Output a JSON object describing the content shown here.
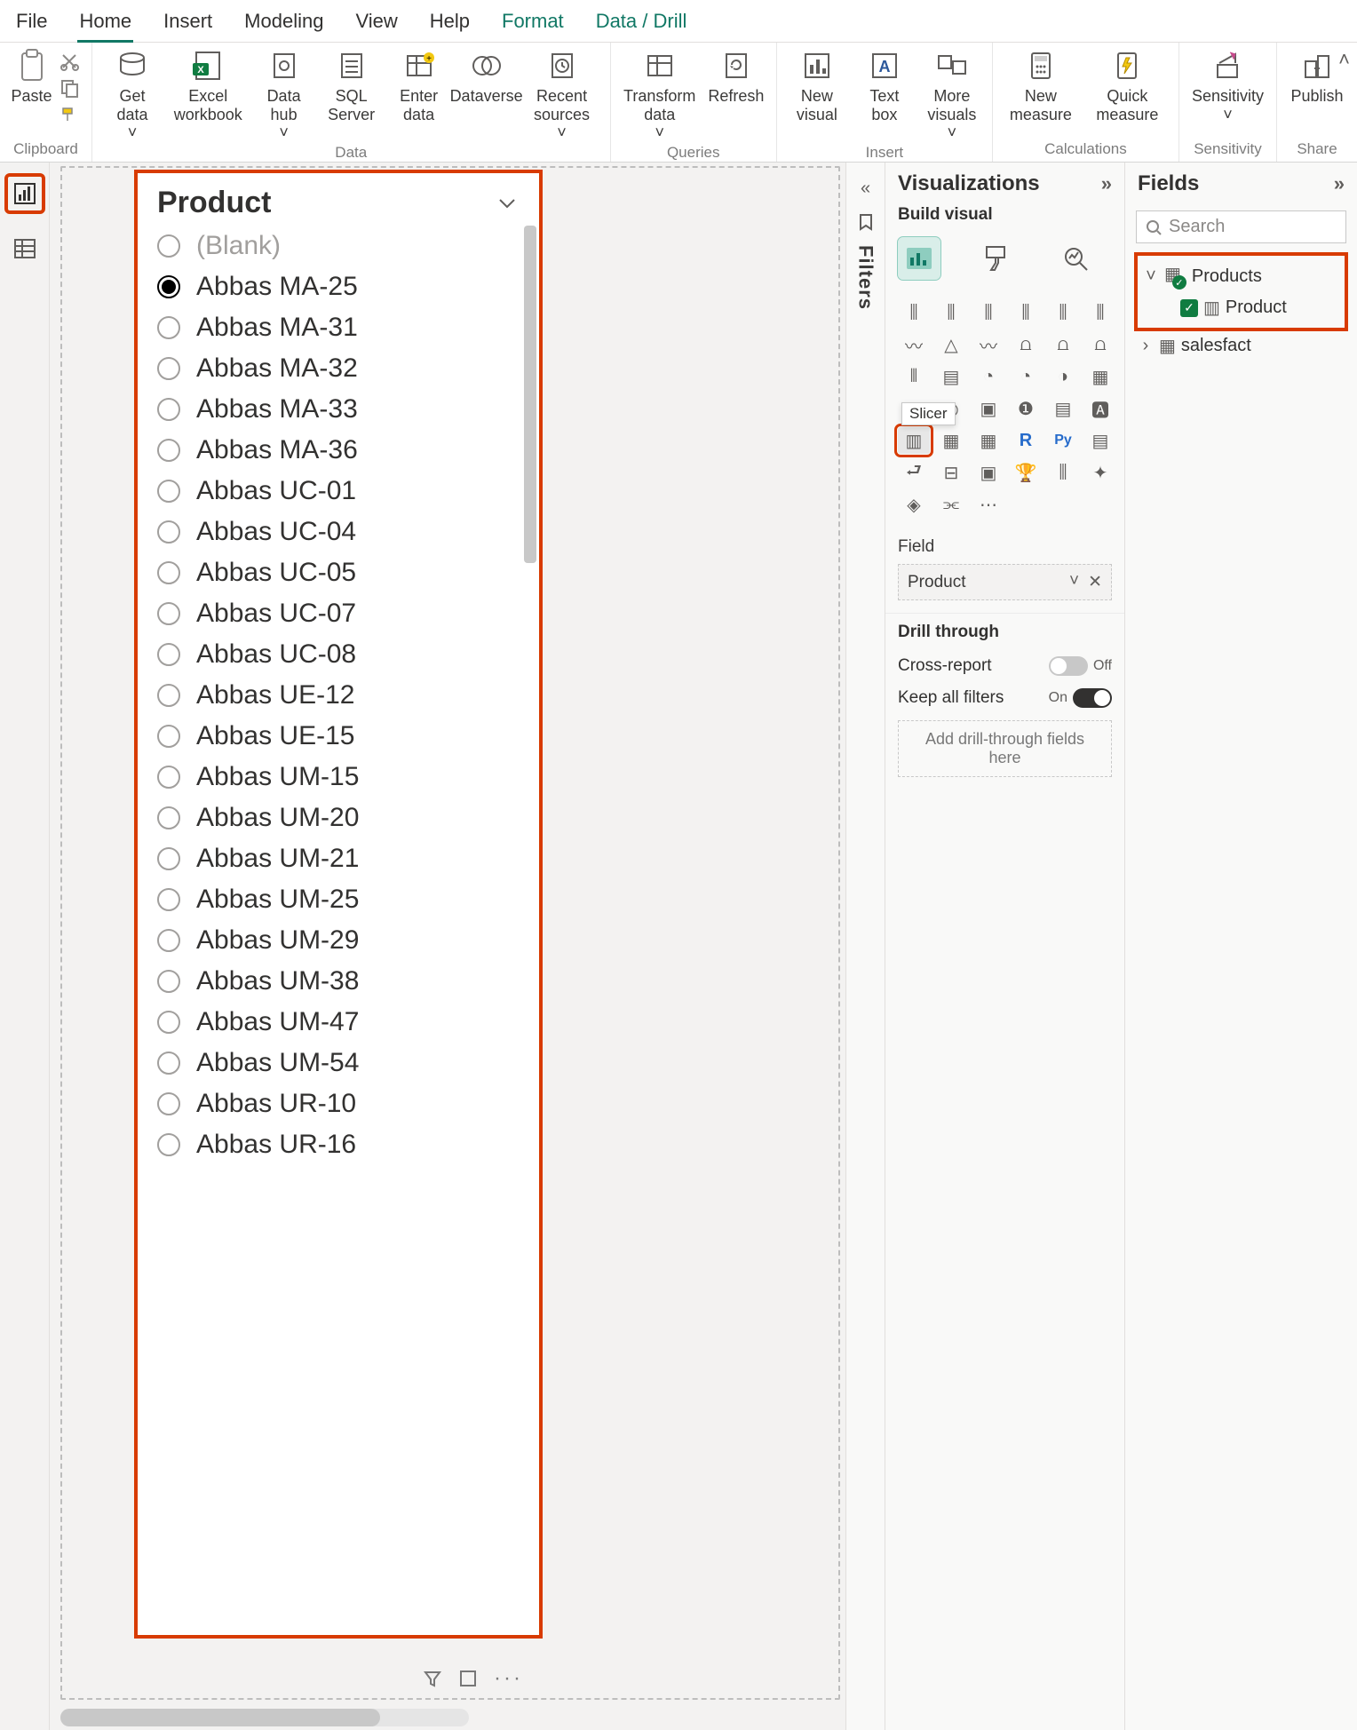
{
  "ribbon": {
    "tabs": [
      "File",
      "Home",
      "Insert",
      "Modeling",
      "View",
      "Help",
      "Format",
      "Data / Drill"
    ],
    "active": "Home",
    "groups": {
      "clipboard": {
        "label": "Clipboard",
        "paste": "Paste"
      },
      "data": {
        "label": "Data",
        "get_data": "Get data",
        "excel": "Excel workbook",
        "data_hub": "Data hub",
        "sql": "SQL Server",
        "enter": "Enter data",
        "dataverse": "Dataverse",
        "recent": "Recent sources"
      },
      "queries": {
        "label": "Queries",
        "transform": "Transform data",
        "refresh": "Refresh"
      },
      "insert": {
        "label": "Insert",
        "newvis": "New visual",
        "textbox": "Text box",
        "morevis": "More visuals"
      },
      "calc": {
        "label": "Calculations",
        "newmeas": "New measure",
        "quickmeas": "Quick measure"
      },
      "sens": {
        "label": "Sensitivity",
        "btn": "Sensitivity"
      },
      "share": {
        "label": "Share",
        "btn": "Publish"
      }
    }
  },
  "slicer": {
    "title": "Product",
    "items": [
      {
        "label": "(Blank)",
        "blank": true,
        "selected": false
      },
      {
        "label": "Abbas MA-25",
        "selected": true
      },
      {
        "label": "Abbas MA-31"
      },
      {
        "label": "Abbas MA-32"
      },
      {
        "label": "Abbas MA-33"
      },
      {
        "label": "Abbas MA-36"
      },
      {
        "label": "Abbas UC-01"
      },
      {
        "label": "Abbas UC-04"
      },
      {
        "label": "Abbas UC-05"
      },
      {
        "label": "Abbas UC-07"
      },
      {
        "label": "Abbas UC-08"
      },
      {
        "label": "Abbas UE-12"
      },
      {
        "label": "Abbas UE-15"
      },
      {
        "label": "Abbas UM-15"
      },
      {
        "label": "Abbas UM-20"
      },
      {
        "label": "Abbas UM-21"
      },
      {
        "label": "Abbas UM-25"
      },
      {
        "label": "Abbas UM-29"
      },
      {
        "label": "Abbas UM-38"
      },
      {
        "label": "Abbas UM-47"
      },
      {
        "label": "Abbas UM-54"
      },
      {
        "label": "Abbas UR-10"
      },
      {
        "label": "Abbas UR-16"
      }
    ]
  },
  "filters_strip": {
    "label": "Filters"
  },
  "viz_pane": {
    "title": "Visualizations",
    "subtitle": "Build visual",
    "tooltip": "Slicer",
    "field_label": "Field",
    "field_value": "Product",
    "drill_title": "Drill through",
    "cross_report": "Cross-report",
    "cross_state": "Off",
    "keepall": "Keep all filters",
    "keepall_state": "On",
    "drill_drop": "Add drill-through fields here"
  },
  "fields_pane": {
    "title": "Fields",
    "search_placeholder": "Search",
    "tables": [
      {
        "name": "Products",
        "expanded": true,
        "checked": true,
        "columns": [
          {
            "name": "Product",
            "checked": true
          }
        ]
      },
      {
        "name": "salesfact",
        "expanded": false
      }
    ]
  }
}
